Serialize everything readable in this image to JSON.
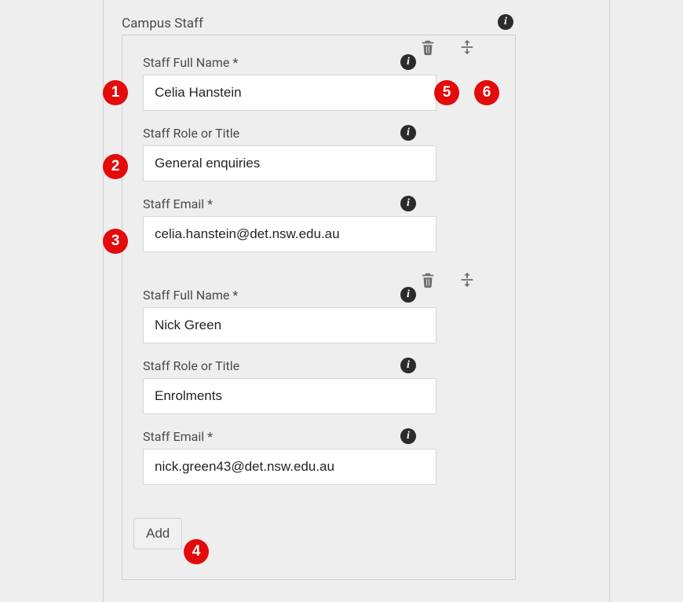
{
  "section": {
    "title": "Campus Staff"
  },
  "staff": [
    {
      "name_label": "Staff Full Name *",
      "name_value": "Celia Hanstein",
      "role_label": "Staff Role or Title",
      "role_value": "General enquiries",
      "email_label": "Staff Email *",
      "email_value": "celia.hanstein@det.nsw.edu.au"
    },
    {
      "name_label": "Staff Full Name *",
      "name_value": "Nick Green",
      "role_label": "Staff Role or Title",
      "role_value": "Enrolments",
      "email_label": "Staff Email *",
      "email_value": "nick.green43@det.nsw.edu.au"
    }
  ],
  "buttons": {
    "add": "Add"
  },
  "markers": {
    "m1": "1",
    "m2": "2",
    "m3": "3",
    "m4": "4",
    "m5": "5",
    "m6": "6"
  }
}
